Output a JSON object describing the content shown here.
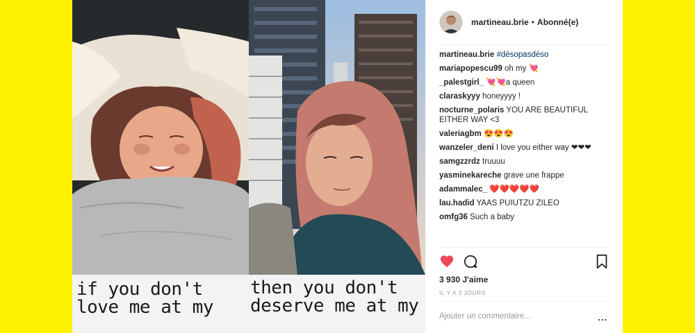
{
  "post": {
    "caption_left": "if you don't love me at my",
    "caption_right": "then you don't deserve me at my"
  },
  "header": {
    "username": "martineau.brie",
    "separator": "•",
    "follow_status": "Abonné(e)"
  },
  "comments": [
    {
      "user": "martineau.brie",
      "text": "#désopasdéso"
    },
    {
      "user": "mariapopescu99",
      "text": "oh my 💘"
    },
    {
      "user": "_palestgirl_",
      "text": "💘💘a queen"
    },
    {
      "user": "claraskyyy",
      "text": "honeyyyy !"
    },
    {
      "user": "nocturne_polaris",
      "text": "YOU ARE BEAUTIFUL EITHER WAY <3"
    },
    {
      "user": "valeriagbm",
      "text": "😍😍😍"
    },
    {
      "user": "wanzeler_deni",
      "text": "I love you either way ❤❤❤"
    },
    {
      "user": "samgzzrdz",
      "text": "truuuu"
    },
    {
      "user": "yasminekareche",
      "text": "grave une frappe"
    },
    {
      "user": "adammalec_",
      "text": "❤️❤️❤️❤️❤️"
    },
    {
      "user": "lau.hadid",
      "text": "YAAS PUIUTZU ZILEO"
    },
    {
      "user": "omfg36",
      "text": "Such a baby"
    }
  ],
  "stats": {
    "likes": "3 930 J'aime",
    "time": "IL Y A 3 JOURS"
  },
  "add_comment": {
    "placeholder": "Ajouter un commentaire...",
    "more": "..."
  },
  "icons": {
    "like": "heart-icon",
    "comment": "comment-bubble-icon",
    "save": "bookmark-icon",
    "more": "more-options-icon"
  },
  "colors": {
    "background": "#fff200",
    "like_red": "#ed4956",
    "hashtag": "#003569"
  }
}
